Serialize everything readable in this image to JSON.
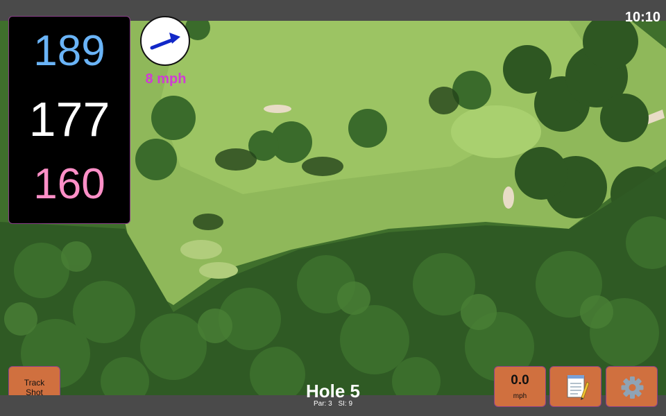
{
  "status_bar": {
    "time": "10:10"
  },
  "yardages": {
    "back": "189",
    "middle": "177",
    "front": "160"
  },
  "wind": {
    "speed_label": "8 mph",
    "icon": "wind-arrow-icon",
    "direction": "east-north-east"
  },
  "buttons": {
    "track_shot_line1": "Track",
    "track_shot_line2": "Shot",
    "speed_value": "0.0",
    "speed_unit": "mph",
    "notes_icon": "notepad-icon",
    "settings_icon": "gear-icon"
  },
  "hole": {
    "title": "Hole 5",
    "par": "Par: 3",
    "si": "SI: 9"
  },
  "colors": {
    "button": "#d0703f",
    "back_yardage": "#6ab4f7",
    "front_yardage": "#ff8fc7",
    "wind_text": "#d13ad6"
  }
}
